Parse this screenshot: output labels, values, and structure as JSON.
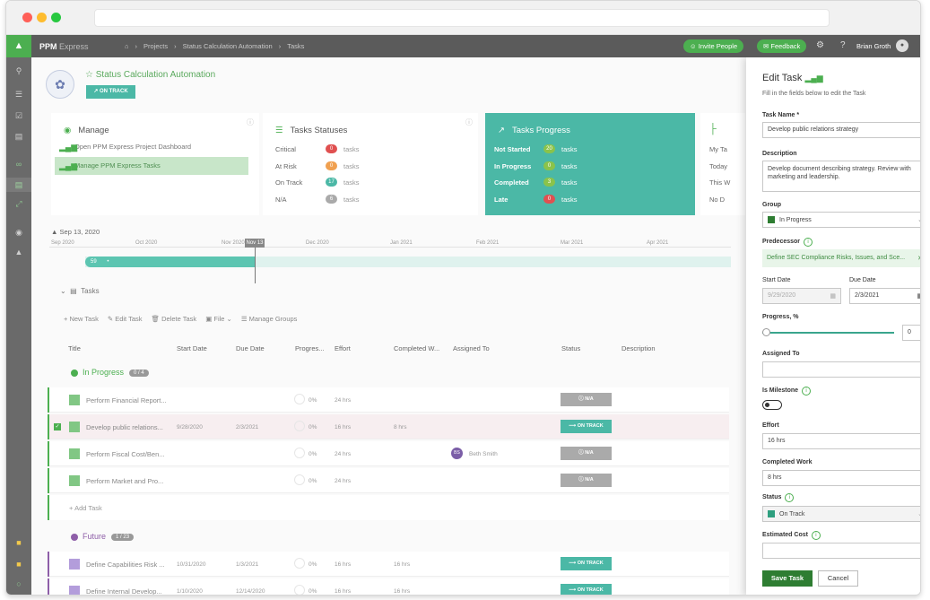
{
  "app": {
    "brand": "PPM",
    "brand_sub": "Express"
  },
  "breadcrumb": [
    "Projects",
    "Status Calculation Automation",
    "Tasks"
  ],
  "header": {
    "invite": "Invite People",
    "feedback": "Feedback",
    "user": "Brian Groth"
  },
  "project": {
    "title": "Status Calculation Automation",
    "status": "ON TRACK"
  },
  "manage": {
    "title": "Manage",
    "items": [
      "Open PPM Express Project Dashboard",
      "Manage PPM Express Tasks"
    ]
  },
  "statuses": {
    "title": "Tasks Statuses",
    "rows": [
      {
        "label": "Critical",
        "count": "0",
        "unit": "tasks",
        "color": "#e05050"
      },
      {
        "label": "At Risk",
        "count": "0",
        "unit": "tasks",
        "color": "#f0a050"
      },
      {
        "label": "On Track",
        "count": "17",
        "unit": "tasks",
        "color": "#4bb8a6"
      },
      {
        "label": "N/A",
        "count": "6",
        "unit": "tasks",
        "color": "#aaaaaa"
      }
    ]
  },
  "progress": {
    "title": "Tasks Progress",
    "rows": [
      {
        "label": "Not Started",
        "count": "20",
        "unit": "tasks",
        "color": "#8bc34a"
      },
      {
        "label": "In Progress",
        "count": "0",
        "unit": "tasks",
        "color": "#8bc34a"
      },
      {
        "label": "Completed",
        "count": "3",
        "unit": "tasks",
        "color": "#8bc34a"
      },
      {
        "label": "Late",
        "count": "0",
        "unit": "tasks",
        "color": "#e05050"
      }
    ]
  },
  "extra_card": {
    "lines": [
      "My Ta",
      "Today",
      "This W",
      "No D"
    ]
  },
  "timeline": {
    "date": "Sep 13, 2020",
    "months": [
      "Sep 2020",
      "Oct 2020",
      "Nov 2020",
      "Dec 2020",
      "Jan 2021",
      "Feb 2021",
      "Mar 2021",
      "Apr 2021"
    ],
    "today": "Nov 13",
    "bar_label": "59"
  },
  "tasks": {
    "heading": "Tasks",
    "toolbar": [
      "New Task",
      "Edit Task",
      "Delete Task",
      "File",
      "Manage Groups"
    ],
    "columns": [
      "Title",
      "Start Date",
      "Due Date",
      "Progres...",
      "Effort",
      "Completed W...",
      "Assigned To",
      "Status",
      "Description"
    ],
    "groups": [
      {
        "name": "In Progress",
        "count": "0 / 4",
        "color": "#4caf50"
      },
      {
        "name": "Future",
        "count": "1 / 23",
        "color": "#8e5ea8"
      }
    ],
    "rows": [
      {
        "title": "Perform Financial Report...",
        "start": "",
        "due": "",
        "progress": "0%",
        "effort": "24 hrs",
        "completed": "",
        "assigned": "",
        "status": "N/A"
      },
      {
        "title": "Develop public relations...",
        "start": "9/28/2020",
        "due": "2/3/2021",
        "progress": "0%",
        "effort": "16 hrs",
        "completed": "8 hrs",
        "assigned": "",
        "status": "ON TRACK"
      },
      {
        "title": "Perform Fiscal Cost/Ben...",
        "start": "",
        "due": "",
        "progress": "0%",
        "effort": "24 hrs",
        "completed": "",
        "assigned": "Beth Smith",
        "status": "N/A"
      },
      {
        "title": "Perform Market and Pro...",
        "start": "",
        "due": "",
        "progress": "0%",
        "effort": "24 hrs",
        "completed": "",
        "assigned": "",
        "status": "N/A"
      },
      {
        "title": "Define Capabilities Risk ...",
        "start": "10/31/2020",
        "due": "1/3/2021",
        "progress": "0%",
        "effort": "16 hrs",
        "completed": "16 hrs",
        "assigned": "",
        "status": "ON TRACK"
      },
      {
        "title": "Define Internal Develop...",
        "start": "1/10/2020",
        "due": "12/14/2020",
        "progress": "0%",
        "effort": "16 hrs",
        "completed": "16 hrs",
        "assigned": "",
        "status": "ON TRACK"
      }
    ],
    "add_task": "Add Task",
    "avatar_initials": "BS"
  },
  "panel": {
    "title": "Edit Task",
    "subtitle": "Fill in the fields below to edit the Task",
    "task_name_label": "Task Name *",
    "task_name": "Develop public relations strategy",
    "description_label": "Description",
    "description": "Develop document describing strategy. Review with marketing and leadership.",
    "group_label": "Group",
    "group": "In Progress",
    "predecessor_label": "Predecessor",
    "predecessor": "Define SEC Compliance Risks, Issues, and Sce...",
    "start_label": "Start Date",
    "start": "9/29/2020",
    "due_label": "Due Date",
    "due": "2/3/2021",
    "progress_label": "Progress, %",
    "progress": "0",
    "assigned_label": "Assigned To",
    "milestone_label": "Is Milestone",
    "effort_label": "Effort",
    "effort": "16 hrs",
    "completed_label": "Completed Work",
    "completed": "8 hrs",
    "status_label": "Status",
    "status": "On Track",
    "cost_label": "Estimated Cost",
    "save": "Save Task",
    "cancel": "Cancel"
  }
}
